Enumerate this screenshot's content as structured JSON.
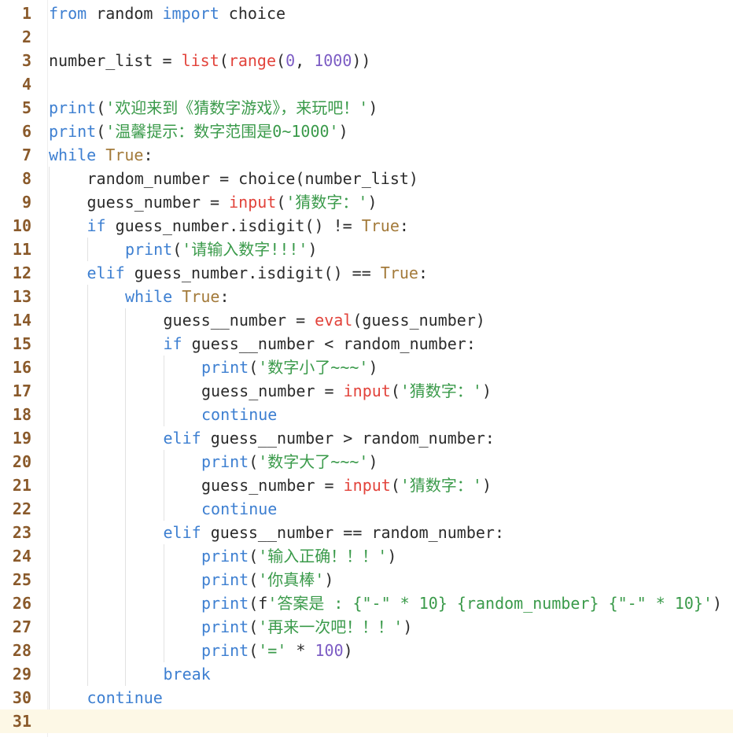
{
  "editor": {
    "current_line": 31,
    "colors": {
      "keyword": "#3d7fd1",
      "boolean": "#a37a3a",
      "builtin": "#e2433b",
      "number": "#7c5cc4",
      "string": "#3a9a4a",
      "text": "#2b2b2b",
      "line_number": "#8a5a2b",
      "current_line_bg": "#fdf8e6"
    },
    "lines": [
      {
        "n": "1",
        "indent": 0,
        "tokens": [
          [
            "from",
            "kw"
          ],
          [
            " random ",
            "id"
          ],
          [
            "import",
            "kw"
          ],
          [
            " choice",
            "id"
          ]
        ]
      },
      {
        "n": "2",
        "indent": 0,
        "tokens": []
      },
      {
        "n": "3",
        "indent": 0,
        "tokens": [
          [
            "number_list = ",
            "id"
          ],
          [
            "list",
            "bi"
          ],
          [
            "(",
            "p"
          ],
          [
            "range",
            "bi"
          ],
          [
            "(",
            "p"
          ],
          [
            "0",
            "num"
          ],
          [
            ", ",
            "p"
          ],
          [
            "1000",
            "num"
          ],
          [
            "))",
            "p"
          ]
        ]
      },
      {
        "n": "4",
        "indent": 0,
        "tokens": []
      },
      {
        "n": "5",
        "indent": 0,
        "tokens": [
          [
            "print",
            "kw"
          ],
          [
            "(",
            "p"
          ],
          [
            "'欢迎来到《猜数字游戏》，来玩吧！'",
            "str"
          ],
          [
            ")",
            "p"
          ]
        ]
      },
      {
        "n": "6",
        "indent": 0,
        "tokens": [
          [
            "print",
            "kw"
          ],
          [
            "(",
            "p"
          ],
          [
            "'温馨提示：数字范围是0~1000'",
            "str"
          ],
          [
            ")",
            "p"
          ]
        ]
      },
      {
        "n": "7",
        "indent": 0,
        "tokens": [
          [
            "while",
            "kw"
          ],
          [
            " ",
            "p"
          ],
          [
            "True",
            "bool"
          ],
          [
            ":",
            "p"
          ]
        ]
      },
      {
        "n": "8",
        "indent": 1,
        "tokens": [
          [
            "random_number = choice(number_list)",
            "id"
          ]
        ]
      },
      {
        "n": "9",
        "indent": 1,
        "tokens": [
          [
            "guess_number = ",
            "id"
          ],
          [
            "input",
            "bi"
          ],
          [
            "(",
            "p"
          ],
          [
            "'猜数字：'",
            "str"
          ],
          [
            ")",
            "p"
          ]
        ]
      },
      {
        "n": "10",
        "indent": 1,
        "tokens": [
          [
            "if",
            "kw"
          ],
          [
            " guess_number.isdigit() != ",
            "id"
          ],
          [
            "True",
            "bool"
          ],
          [
            ":",
            "p"
          ]
        ]
      },
      {
        "n": "11",
        "indent": 2,
        "tokens": [
          [
            "print",
            "kw"
          ],
          [
            "(",
            "p"
          ],
          [
            "'请输入数字!!!'",
            "str"
          ],
          [
            ")",
            "p"
          ]
        ]
      },
      {
        "n": "12",
        "indent": 1,
        "tokens": [
          [
            "elif",
            "kw"
          ],
          [
            " guess_number.isdigit() == ",
            "id"
          ],
          [
            "True",
            "bool"
          ],
          [
            ":",
            "p"
          ]
        ]
      },
      {
        "n": "13",
        "indent": 2,
        "tokens": [
          [
            "while",
            "kw"
          ],
          [
            " ",
            "p"
          ],
          [
            "True",
            "bool"
          ],
          [
            ":",
            "p"
          ]
        ]
      },
      {
        "n": "14",
        "indent": 3,
        "tokens": [
          [
            "guess__number = ",
            "id"
          ],
          [
            "eval",
            "bi"
          ],
          [
            "(guess_number)",
            "p"
          ]
        ]
      },
      {
        "n": "15",
        "indent": 3,
        "tokens": [
          [
            "if",
            "kw"
          ],
          [
            " guess__number < random_number:",
            "id"
          ]
        ]
      },
      {
        "n": "16",
        "indent": 4,
        "tokens": [
          [
            "print",
            "kw"
          ],
          [
            "(",
            "p"
          ],
          [
            "'数字小了~~~'",
            "str"
          ],
          [
            ")",
            "p"
          ]
        ]
      },
      {
        "n": "17",
        "indent": 4,
        "tokens": [
          [
            "guess_number = ",
            "id"
          ],
          [
            "input",
            "bi"
          ],
          [
            "(",
            "p"
          ],
          [
            "'猜数字：'",
            "str"
          ],
          [
            ")",
            "p"
          ]
        ]
      },
      {
        "n": "18",
        "indent": 4,
        "tokens": [
          [
            "continue",
            "kw"
          ]
        ]
      },
      {
        "n": "19",
        "indent": 3,
        "tokens": [
          [
            "elif",
            "kw"
          ],
          [
            " guess__number > random_number:",
            "id"
          ]
        ]
      },
      {
        "n": "20",
        "indent": 4,
        "tokens": [
          [
            "print",
            "kw"
          ],
          [
            "(",
            "p"
          ],
          [
            "'数字大了~~~'",
            "str"
          ],
          [
            ")",
            "p"
          ]
        ]
      },
      {
        "n": "21",
        "indent": 4,
        "tokens": [
          [
            "guess_number = ",
            "id"
          ],
          [
            "input",
            "bi"
          ],
          [
            "(",
            "p"
          ],
          [
            "'猜数字：'",
            "str"
          ],
          [
            ")",
            "p"
          ]
        ]
      },
      {
        "n": "22",
        "indent": 4,
        "tokens": [
          [
            "continue",
            "kw"
          ]
        ]
      },
      {
        "n": "23",
        "indent": 3,
        "tokens": [
          [
            "elif",
            "kw"
          ],
          [
            " guess__number == random_number:",
            "id"
          ]
        ]
      },
      {
        "n": "24",
        "indent": 4,
        "tokens": [
          [
            "print",
            "kw"
          ],
          [
            "(",
            "p"
          ],
          [
            "'输入正确！！！'",
            "str"
          ],
          [
            ")",
            "p"
          ]
        ]
      },
      {
        "n": "25",
        "indent": 4,
        "tokens": [
          [
            "print",
            "kw"
          ],
          [
            "(",
            "p"
          ],
          [
            "'你真棒'",
            "str"
          ],
          [
            ")",
            "p"
          ]
        ]
      },
      {
        "n": "26",
        "indent": 4,
        "tokens": [
          [
            "print",
            "kw"
          ],
          [
            "(f",
            "p"
          ],
          [
            "'答案是 : {\"-\" * 10} {random_number} {\"-\" * 10}'",
            "str"
          ],
          [
            ")",
            "p"
          ]
        ]
      },
      {
        "n": "27",
        "indent": 4,
        "tokens": [
          [
            "print",
            "kw"
          ],
          [
            "(",
            "p"
          ],
          [
            "'再来一次吧！！！'",
            "str"
          ],
          [
            ")",
            "p"
          ]
        ]
      },
      {
        "n": "28",
        "indent": 4,
        "tokens": [
          [
            "print",
            "kw"
          ],
          [
            "(",
            "p"
          ],
          [
            "'='",
            "str"
          ],
          [
            " * ",
            "p"
          ],
          [
            "100",
            "num"
          ],
          [
            ")",
            "p"
          ]
        ]
      },
      {
        "n": "29",
        "indent": 3,
        "tokens": [
          [
            "break",
            "kw"
          ]
        ]
      },
      {
        "n": "30",
        "indent": 1,
        "tokens": [
          [
            "continue",
            "kw"
          ]
        ]
      },
      {
        "n": "31",
        "indent": 0,
        "tokens": []
      }
    ]
  }
}
